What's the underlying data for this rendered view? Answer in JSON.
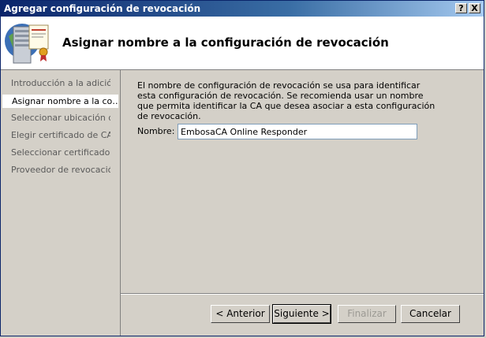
{
  "window": {
    "title": "Agregar configuración de revocación",
    "help_btn": "?",
    "close_btn": "X"
  },
  "header": {
    "title": "Asignar nombre a la configuración de revocación",
    "icon": "server-certificate-icon"
  },
  "sidebar": {
    "items": [
      {
        "label": "Introducción a la adició…"
      },
      {
        "label": "Asignar nombre a la co…"
      },
      {
        "label": "Seleccionar ubicación d…"
      },
      {
        "label": "Elegir certificado de CA"
      },
      {
        "label": "Seleccionar certificado …"
      },
      {
        "label": "Proveedor de revocación"
      }
    ],
    "active_index": 1
  },
  "main": {
    "description": "El nombre de configuración de revocación se usa para identificar esta configuración de revocación. Se recomienda usar un nombre que permita identificar la CA que desea asociar a esta configuración de revocación.",
    "name_label": "Nombre:",
    "name_value": "EmbosaCA Online Responder"
  },
  "buttons": {
    "back": "< Anterior",
    "next": "Siguiente >",
    "finish": "Finalizar",
    "cancel": "Cancelar"
  }
}
